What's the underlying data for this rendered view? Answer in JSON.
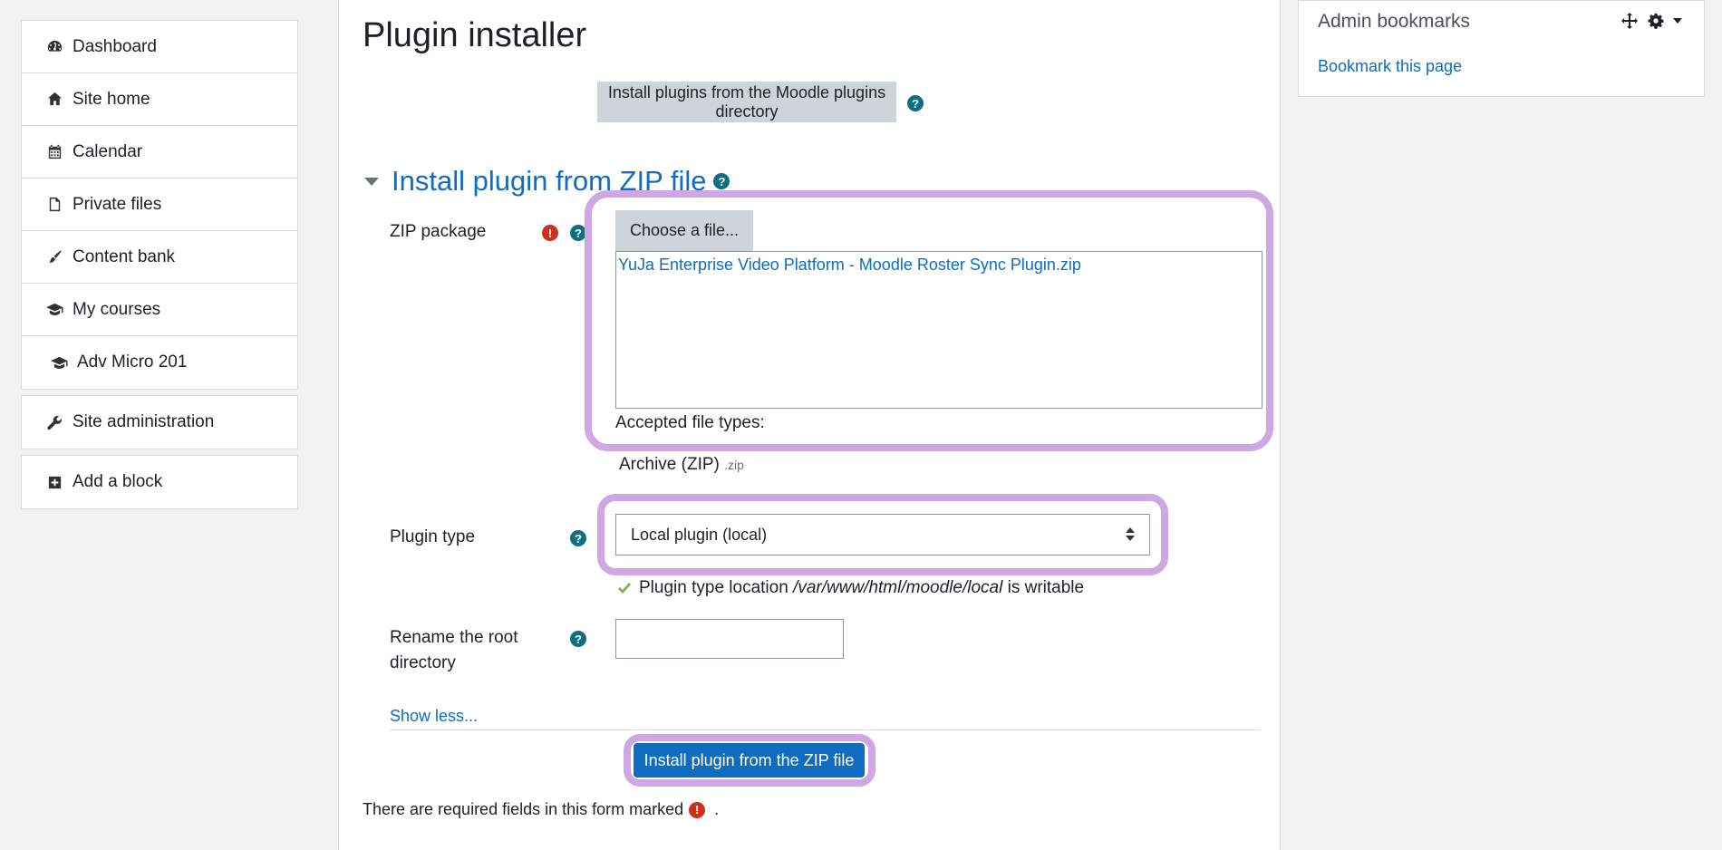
{
  "sidebar": {
    "items": [
      {
        "label": "Dashboard",
        "icon": "dashboard-icon"
      },
      {
        "label": "Site home",
        "icon": "home-icon"
      },
      {
        "label": "Calendar",
        "icon": "calendar-icon"
      },
      {
        "label": "Private files",
        "icon": "file-icon"
      },
      {
        "label": "Content bank",
        "icon": "brush-icon"
      },
      {
        "label": "My courses",
        "icon": "graduation-cap-icon"
      },
      {
        "label": "Adv Micro 201",
        "icon": "graduation-cap-icon"
      }
    ],
    "admin_label": "Site administration",
    "add_block_label": "Add a block"
  },
  "main": {
    "title": "Plugin installer",
    "directory_button": "Install plugins from the Moodle plugins directory",
    "section_title": "Install plugin from ZIP file",
    "zip_label": "ZIP package",
    "choose_file": "Choose a file...",
    "file_name": "YuJa Enterprise Video Platform - Moodle Roster Sync Plugin.zip",
    "accepted_types_label": "Accepted file types:",
    "archive_label": "Archive (ZIP)",
    "archive_ext": ".zip",
    "plugin_type_label": "Plugin type",
    "plugin_type_value": "Local plugin (local)",
    "location_prefix": "Plugin type location",
    "location_path": "/var/www/html/moodle/local",
    "location_suffix": "is writable",
    "rename_label_1": "Rename the root",
    "rename_label_2": "directory",
    "show_less": "Show less...",
    "install_button": "Install plugin from the ZIP file",
    "required_note": "There are required fields in this form marked",
    "required_note_end": "."
  },
  "right_block": {
    "title": "Admin bookmarks",
    "link": "Bookmark this page"
  },
  "colors": {
    "accent": "#0f6cbf",
    "help": "#0f6e84",
    "required": "#ca3120",
    "highlight": "#cda8e2",
    "check": "#7cb342"
  }
}
